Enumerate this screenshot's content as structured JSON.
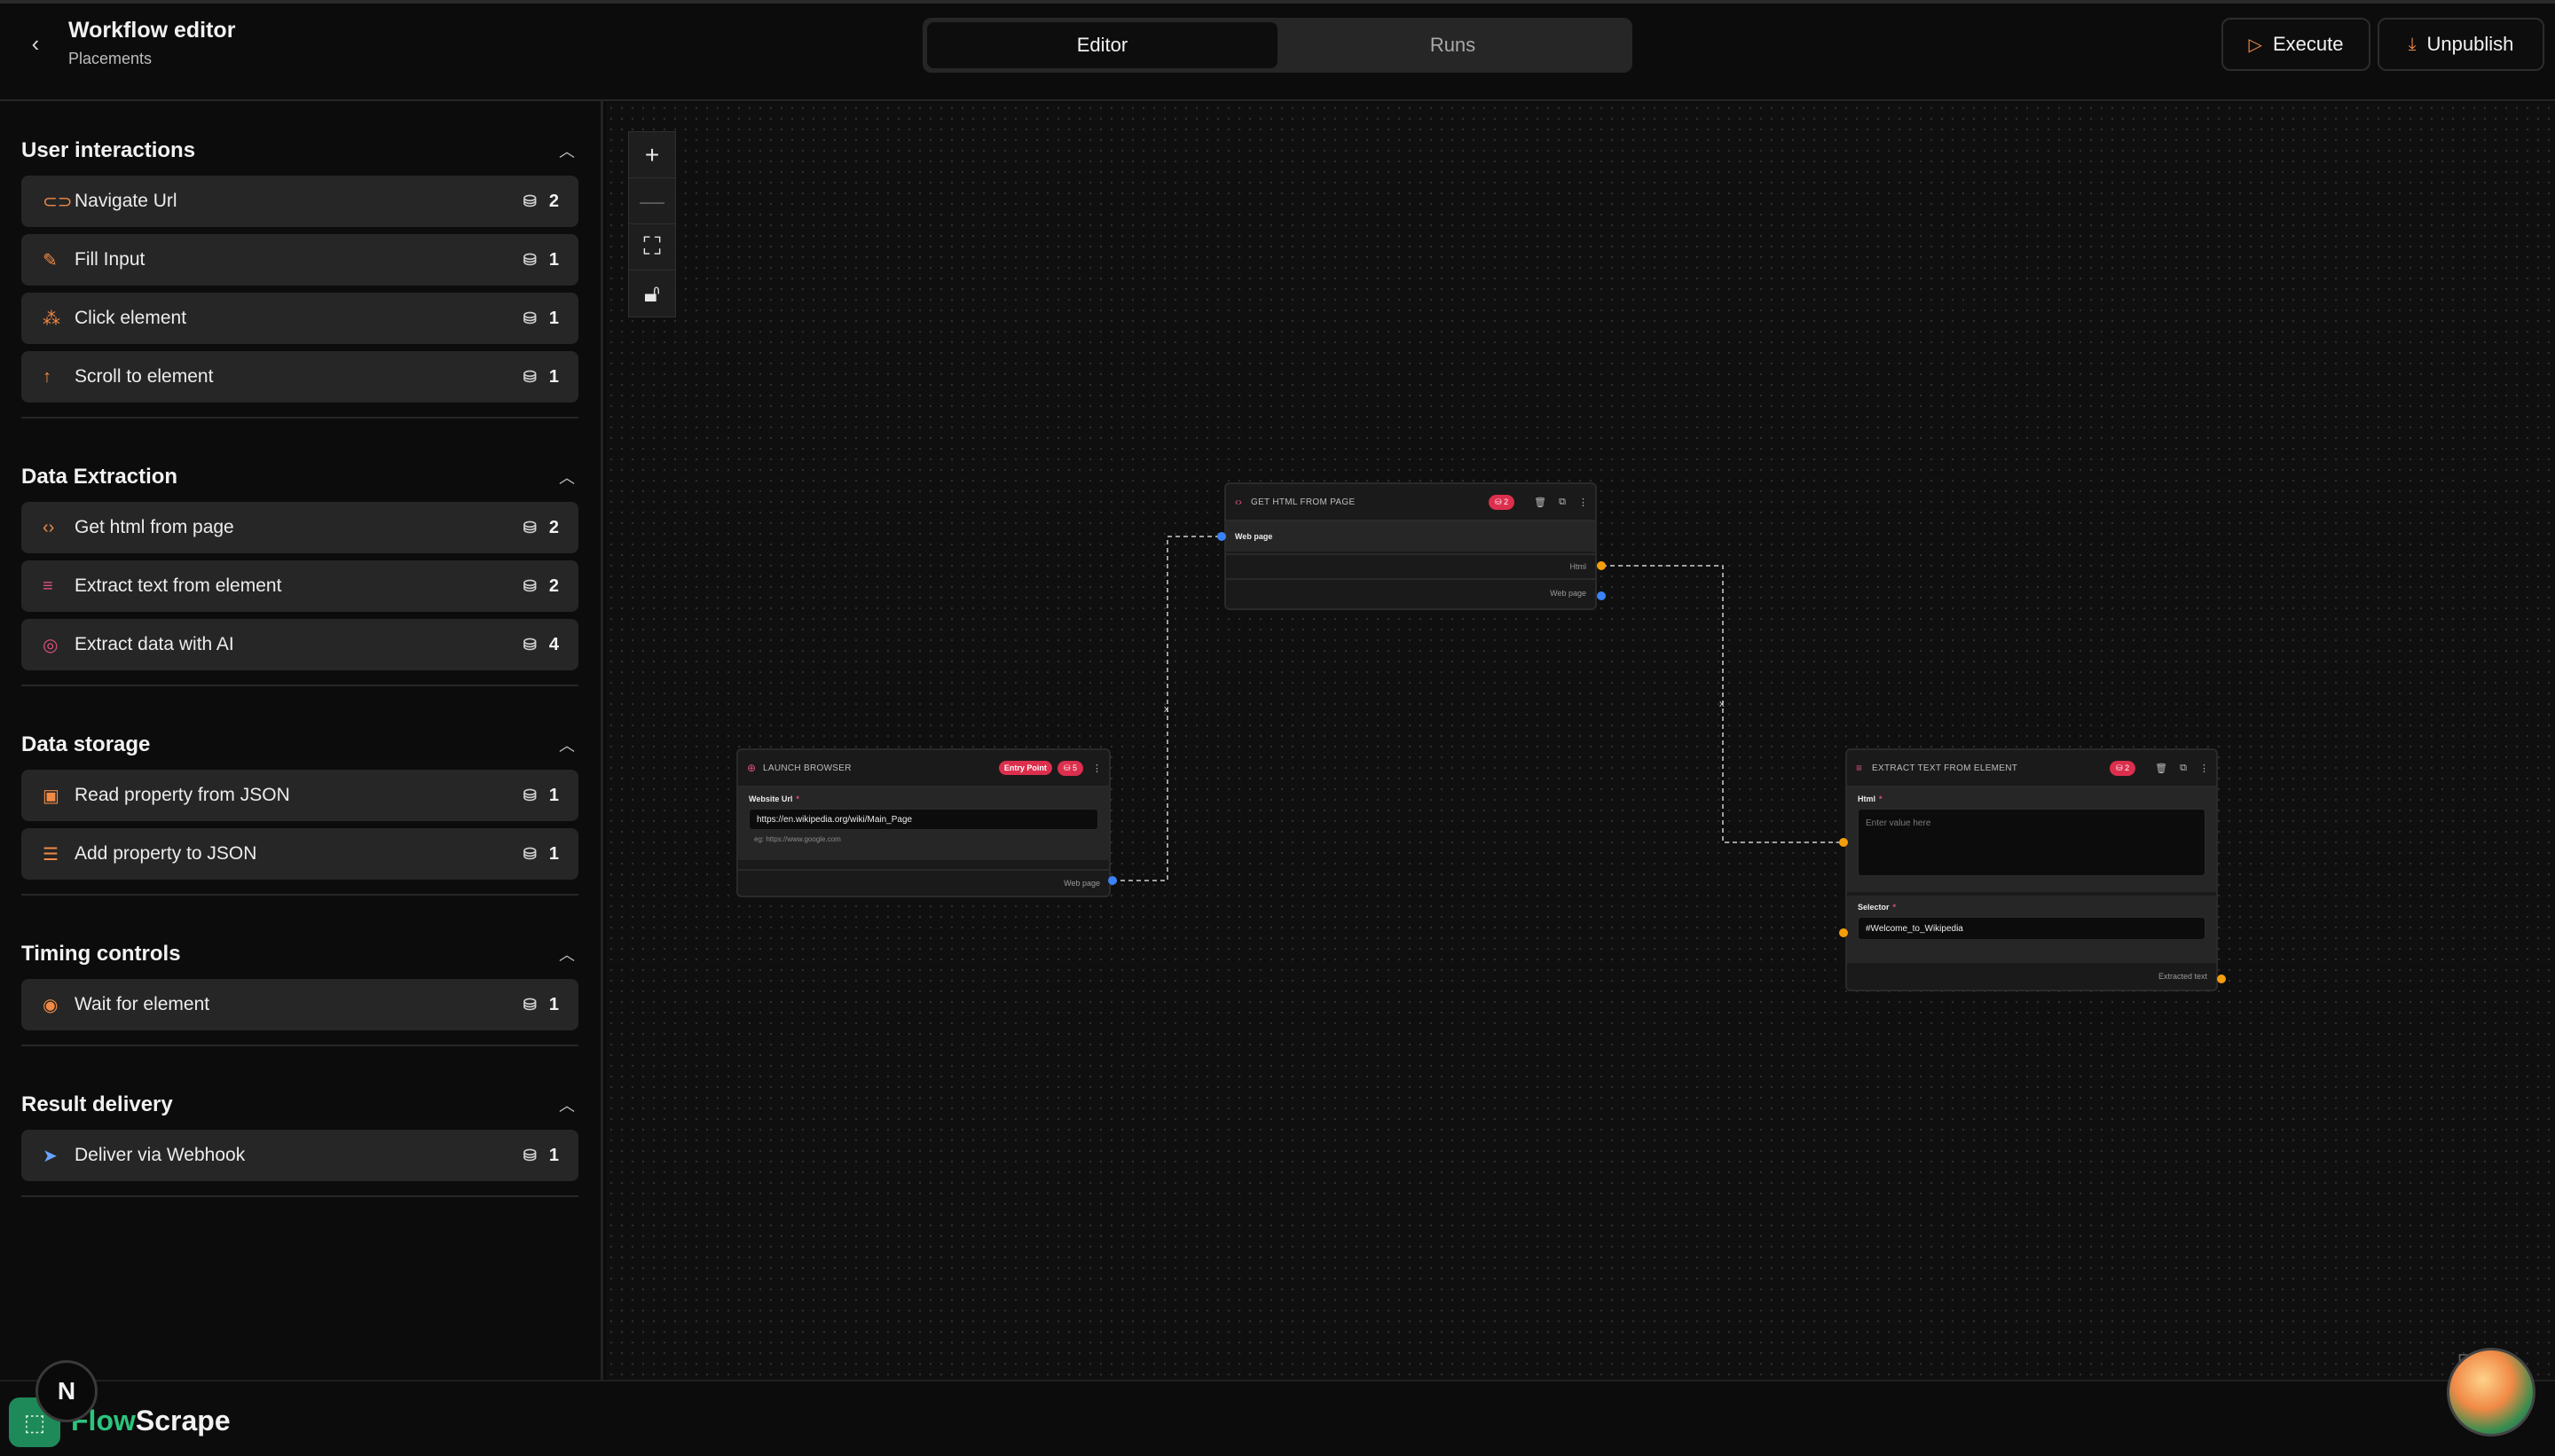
{
  "header": {
    "title": "Workflow editor",
    "subtitle": "Placements",
    "tabs": [
      {
        "label": "Editor"
      },
      {
        "label": "Runs"
      }
    ],
    "execute_label": "Execute",
    "unpublish_label": "Unpublish"
  },
  "sidebar": {
    "sections": [
      {
        "title": "User interactions",
        "items": [
          {
            "label": "Navigate Url",
            "count": "2",
            "icon": "link-icon"
          },
          {
            "label": "Fill Input",
            "count": "1",
            "icon": "pencil-icon"
          },
          {
            "label": "Click element",
            "count": "1",
            "icon": "pointer-click-icon"
          },
          {
            "label": "Scroll to element",
            "count": "1",
            "icon": "arrow-up-icon"
          }
        ]
      },
      {
        "title": "Data Extraction",
        "items": [
          {
            "label": "Get html from page",
            "count": "2",
            "icon": "code-icon"
          },
          {
            "label": "Extract text from element",
            "count": "2",
            "icon": "text-lines-icon"
          },
          {
            "label": "Extract data with AI",
            "count": "4",
            "icon": "brain-icon"
          }
        ]
      },
      {
        "title": "Data storage",
        "items": [
          {
            "label": "Read property from JSON",
            "count": "1",
            "icon": "file-json-icon"
          },
          {
            "label": "Add property to JSON",
            "count": "1",
            "icon": "database-icon"
          }
        ]
      },
      {
        "title": "Timing controls",
        "items": [
          {
            "label": "Wait for element",
            "count": "1",
            "icon": "eye-icon"
          }
        ]
      },
      {
        "title": "Result delivery",
        "items": [
          {
            "label": "Deliver via Webhook",
            "count": "1",
            "icon": "send-icon"
          }
        ]
      }
    ]
  },
  "nodes": {
    "launch": {
      "title": "LAUNCH BROWSER",
      "entry_badge": "Entry Point",
      "cost": "5",
      "field_label": "Website Url",
      "field_value": "https://en.wikipedia.org/wiki/Main_Page",
      "hint": "eg: https://www.google.com",
      "output": "Web page"
    },
    "get_html": {
      "title": "GET HTML FROM PAGE",
      "cost": "2",
      "input": "Web page",
      "output1": "Html",
      "output2": "Web page"
    },
    "extract_text": {
      "title": "EXTRACT TEXT FROM ELEMENT",
      "cost": "2",
      "html_label": "Html",
      "html_placeholder": "Enter value here",
      "selector_label": "Selector",
      "selector_value": "#Welcome_to_Wikipedia",
      "output": "Extracted text"
    }
  },
  "edges": [
    {
      "label": "x"
    },
    {
      "label": "x"
    }
  ],
  "footer": {
    "logo_part1": "Flow",
    "logo_part2": "Scrape",
    "n_badge": "N",
    "flow_tag": "Flow"
  },
  "colors": {
    "accent_orange": "#f08a46",
    "badge_red": "#dc2f4d",
    "brand_green": "#2bc47d",
    "port_blue": "#3b82f6",
    "port_orange": "#f59e0b"
  }
}
